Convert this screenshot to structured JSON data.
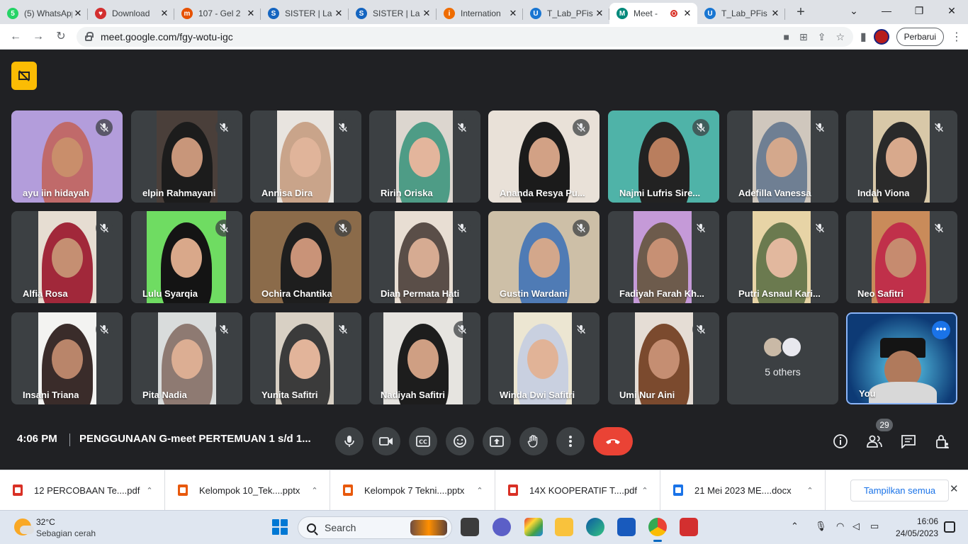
{
  "browser": {
    "tabs": [
      {
        "label": "(5) WhatsApp",
        "color": "#25d366",
        "glyph": "5"
      },
      {
        "label": "Download",
        "color": "#d32f2f",
        "glyph": "♥"
      },
      {
        "label": "107 - Gel 2",
        "color": "#e65100",
        "glyph": "m"
      },
      {
        "label": "SISTER | La",
        "color": "#1565c0",
        "glyph": "S"
      },
      {
        "label": "SISTER | La",
        "color": "#1565c0",
        "glyph": "S"
      },
      {
        "label": "Internation",
        "color": "#ef6c00",
        "glyph": "i"
      },
      {
        "label": "T_Lab_PFis",
        "color": "#1976d2",
        "glyph": "U"
      },
      {
        "label": "Meet -",
        "color": "#00897b",
        "glyph": "M",
        "active": true
      },
      {
        "label": "T_Lab_PFis",
        "color": "#1976d2",
        "glyph": "U"
      }
    ],
    "url": "meet.google.com/fgy-wotu-igc",
    "update_label": "Perbarui"
  },
  "meet": {
    "participants": [
      {
        "name": "ayu iin hidayah",
        "bg": "#b39ddb",
        "hijab": "#c06a6a",
        "skin": "#c98e6b"
      },
      {
        "name": "elpin Rahmayani",
        "bg": "#4a3f3a",
        "hijab": "#1c1c1c",
        "skin": "#c8967a"
      },
      {
        "name": "Annisa Dira",
        "bg": "#e8e4df",
        "hijab": "#c9a48a",
        "skin": "#e0b49a"
      },
      {
        "name": "Ririn Oriska",
        "bg": "#dcd6cf",
        "hijab": "#4e9c86",
        "skin": "#e3b59c"
      },
      {
        "name": "Ananda Resya Pu...",
        "bg": "#e9e1d8",
        "hijab": "#1b1b1b",
        "skin": "#d2a185"
      },
      {
        "name": "Najmi Lufris Sire...",
        "bg": "#4fb3a8",
        "hijab": "#222222",
        "skin": "#b97e5e"
      },
      {
        "name": "Adefilla Vanessa",
        "bg": "#cfc7bd",
        "hijab": "#6f7f93",
        "skin": "#d4a88c"
      },
      {
        "name": "Indah Viona",
        "bg": "#d8c8a8",
        "hijab": "#2a2a2a",
        "skin": "#d8a98c"
      },
      {
        "name": "Alfia Rosa",
        "bg": "#e6ddd2",
        "hijab": "#a1283a",
        "skin": "#c58f72"
      },
      {
        "name": "Lulu Syarqia",
        "bg": "#6fdc62",
        "hijab": "#141414",
        "skin": "#d9a88a"
      },
      {
        "name": "Ochira Chantika",
        "bg": "#8b6b4a",
        "hijab": "#1e1e1e",
        "skin": "#c99378"
      },
      {
        "name": "Dian Permata Hati",
        "bg": "#e8ded3",
        "hijab": "#5a4e48",
        "skin": "#d6ab92"
      },
      {
        "name": "Gustin Wardani",
        "bg": "#cdbfa7",
        "hijab": "#4f7bb5",
        "skin": "#d3a78b"
      },
      {
        "name": "Fadiyah Farah Kh...",
        "bg": "#c59ad8",
        "hijab": "#6d5b4c",
        "skin": "#c79074"
      },
      {
        "name": "Putri Asnaul Kari...",
        "bg": "#e7d4a6",
        "hijab": "#6b7a4f",
        "skin": "#e2b89e"
      },
      {
        "name": "Neo Safitri",
        "bg": "#c98b5a",
        "hijab": "#c0304a",
        "skin": "#c68b6f"
      },
      {
        "name": "Insani Triana",
        "bg": "#f3f3f1",
        "hijab": "#3a2c2a",
        "skin": "#b9856a"
      },
      {
        "name": "Pita Nadia",
        "bg": "#d9dcdc",
        "hijab": "#8e7a72",
        "skin": "#dcae93"
      },
      {
        "name": "Yunita Safitri",
        "bg": "#d8d0c4",
        "hijab": "#3b3b3b",
        "skin": "#e2b49a"
      },
      {
        "name": "Nadiyah Safitri",
        "bg": "#e6e4e0",
        "hijab": "#1d1d1d",
        "skin": "#cf9f83"
      },
      {
        "name": "Winda Dwi Safitri",
        "bg": "#ece6d2",
        "hijab": "#c9d0e0",
        "skin": "#e1b397"
      },
      {
        "name": "Umi Nur Aini",
        "bg": "#e5ddd5",
        "hijab": "#7b4a2e",
        "skin": "#c58e72"
      }
    ],
    "others_label": "5 others",
    "self_label": "You",
    "clock": "4:06 PM",
    "meeting_title": "PENGGUNAAN G-meet PERTEMUAN 1 s/d 1...",
    "people_count": "29"
  },
  "downloads": {
    "items": [
      {
        "name": "12 PERCOBAAN Te....pdf",
        "color": "#d93025"
      },
      {
        "name": "Kelompok 10_Tek....pptx",
        "color": "#e8590c"
      },
      {
        "name": "Kelompok 7 Tekni....pptx",
        "color": "#e8590c"
      },
      {
        "name": "14X KOOPERATIF T....pdf",
        "color": "#d93025"
      },
      {
        "name": "21 Mei 2023 ME....docx",
        "color": "#1a73e8"
      }
    ],
    "show_all_label": "Tampilkan semua"
  },
  "taskbar": {
    "temperature": "32°C",
    "weather": "Sebagian cerah",
    "search_label": "Search",
    "time": "16:06",
    "date": "24/05/2023"
  }
}
